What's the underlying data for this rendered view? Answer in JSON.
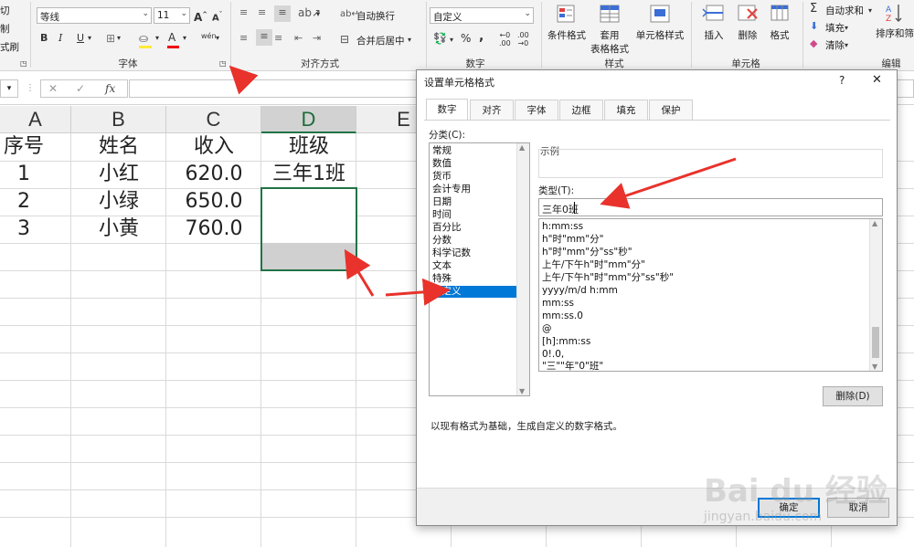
{
  "ribbon": {
    "clipboard": {
      "cut": "切",
      "copy": "制",
      "painter": "式刷"
    },
    "font": {
      "name": "等线",
      "size": "11",
      "grow": "A",
      "shrink": "A",
      "bold": "B",
      "italic": "I",
      "underline": "U",
      "color_glyph": "A",
      "phonetic": "wén",
      "label": "字体"
    },
    "alignment": {
      "wrap": "自动换行",
      "merge": "合并后居中",
      "label": "对齐方式"
    },
    "number": {
      "format": "自定义",
      "percent": "%",
      "comma": ",",
      "inc_dec": ".00",
      "label": "数字"
    },
    "styles": {
      "conditional": "条件格式",
      "table1": "套用",
      "table2": "表格格式",
      "cell_style": "单元格样式",
      "label": "样式"
    },
    "cells": {
      "insert": "插入",
      "delete": "删除",
      "format": "格式",
      "label": "单元格"
    },
    "editing": {
      "autosum": "自动求和",
      "fill": "填充",
      "clear": "清除",
      "sort": "排序和筛",
      "label": "编辑"
    }
  },
  "formula_bar": {
    "fx": "fx",
    "cancel": "✕",
    "enter": "✓"
  },
  "sheet": {
    "columns": [
      "A",
      "B",
      "C",
      "D",
      "E"
    ],
    "rows": [
      [
        "序号",
        "姓名",
        "收入",
        "班级"
      ],
      [
        "1",
        "小红",
        "620.0",
        "三年1班"
      ],
      [
        "2",
        "小绿",
        "650.0",
        ""
      ],
      [
        "3",
        "小黄",
        "760.0",
        ""
      ]
    ]
  },
  "dialog": {
    "title": "设置单元格格式",
    "help": "?",
    "close": "✕",
    "tabs": [
      "数字",
      "对齐",
      "字体",
      "边框",
      "填充",
      "保护"
    ],
    "category_label": "分类(C):",
    "categories": [
      "常规",
      "数值",
      "货币",
      "会计专用",
      "日期",
      "时间",
      "百分比",
      "分数",
      "科学记数",
      "文本",
      "特殊",
      "自定义"
    ],
    "selected_category": "自定义",
    "sample_label": "示例",
    "type_label": "类型(T):",
    "type_value": "三年0班",
    "formats": [
      "h:mm:ss",
      "h\"时\"mm\"分\"",
      "h\"时\"mm\"分\"ss\"秒\"",
      "上午/下午h\"时\"mm\"分\"",
      "上午/下午h\"时\"mm\"分\"ss\"秒\"",
      "yyyy/m/d h:mm",
      "mm:ss",
      "mm:ss.0",
      "@",
      "[h]:mm:ss",
      "0!.0,",
      "\"三\"\"年\"0\"班\""
    ],
    "delete_button": "删除(D)",
    "description": "以现有格式为基础，生成自定义的数字格式。",
    "ok": "确定",
    "cancel": "取消"
  },
  "watermark": {
    "brand": "Bai du 经验",
    "url": "jingyan.baidu.com"
  },
  "colors": {
    "accent": "#217346",
    "selection": "#0078d7",
    "arrow": "#e8322b"
  }
}
